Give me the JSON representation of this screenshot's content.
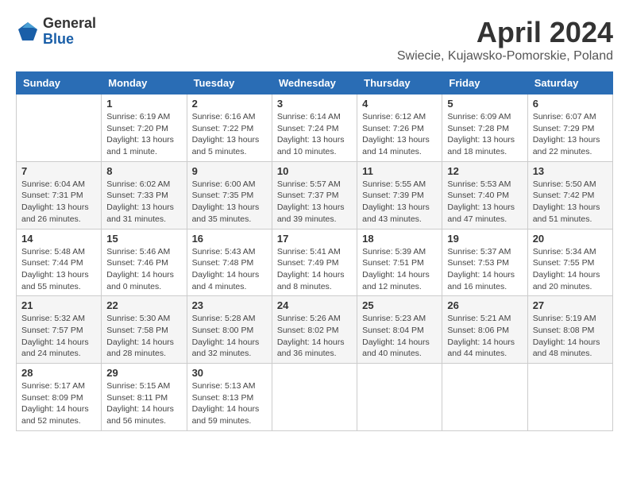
{
  "logo": {
    "general": "General",
    "blue": "Blue"
  },
  "header": {
    "month": "April 2024",
    "location": "Swiecie, Kujawsko-Pomorskie, Poland"
  },
  "weekdays": [
    "Sunday",
    "Monday",
    "Tuesday",
    "Wednesday",
    "Thursday",
    "Friday",
    "Saturday"
  ],
  "weeks": [
    [
      {
        "day": "",
        "info": ""
      },
      {
        "day": "1",
        "info": "Sunrise: 6:19 AM\nSunset: 7:20 PM\nDaylight: 13 hours\nand 1 minute."
      },
      {
        "day": "2",
        "info": "Sunrise: 6:16 AM\nSunset: 7:22 PM\nDaylight: 13 hours\nand 5 minutes."
      },
      {
        "day": "3",
        "info": "Sunrise: 6:14 AM\nSunset: 7:24 PM\nDaylight: 13 hours\nand 10 minutes."
      },
      {
        "day": "4",
        "info": "Sunrise: 6:12 AM\nSunset: 7:26 PM\nDaylight: 13 hours\nand 14 minutes."
      },
      {
        "day": "5",
        "info": "Sunrise: 6:09 AM\nSunset: 7:28 PM\nDaylight: 13 hours\nand 18 minutes."
      },
      {
        "day": "6",
        "info": "Sunrise: 6:07 AM\nSunset: 7:29 PM\nDaylight: 13 hours\nand 22 minutes."
      }
    ],
    [
      {
        "day": "7",
        "info": "Sunrise: 6:04 AM\nSunset: 7:31 PM\nDaylight: 13 hours\nand 26 minutes."
      },
      {
        "day": "8",
        "info": "Sunrise: 6:02 AM\nSunset: 7:33 PM\nDaylight: 13 hours\nand 31 minutes."
      },
      {
        "day": "9",
        "info": "Sunrise: 6:00 AM\nSunset: 7:35 PM\nDaylight: 13 hours\nand 35 minutes."
      },
      {
        "day": "10",
        "info": "Sunrise: 5:57 AM\nSunset: 7:37 PM\nDaylight: 13 hours\nand 39 minutes."
      },
      {
        "day": "11",
        "info": "Sunrise: 5:55 AM\nSunset: 7:39 PM\nDaylight: 13 hours\nand 43 minutes."
      },
      {
        "day": "12",
        "info": "Sunrise: 5:53 AM\nSunset: 7:40 PM\nDaylight: 13 hours\nand 47 minutes."
      },
      {
        "day": "13",
        "info": "Sunrise: 5:50 AM\nSunset: 7:42 PM\nDaylight: 13 hours\nand 51 minutes."
      }
    ],
    [
      {
        "day": "14",
        "info": "Sunrise: 5:48 AM\nSunset: 7:44 PM\nDaylight: 13 hours\nand 55 minutes."
      },
      {
        "day": "15",
        "info": "Sunrise: 5:46 AM\nSunset: 7:46 PM\nDaylight: 14 hours\nand 0 minutes."
      },
      {
        "day": "16",
        "info": "Sunrise: 5:43 AM\nSunset: 7:48 PM\nDaylight: 14 hours\nand 4 minutes."
      },
      {
        "day": "17",
        "info": "Sunrise: 5:41 AM\nSunset: 7:49 PM\nDaylight: 14 hours\nand 8 minutes."
      },
      {
        "day": "18",
        "info": "Sunrise: 5:39 AM\nSunset: 7:51 PM\nDaylight: 14 hours\nand 12 minutes."
      },
      {
        "day": "19",
        "info": "Sunrise: 5:37 AM\nSunset: 7:53 PM\nDaylight: 14 hours\nand 16 minutes."
      },
      {
        "day": "20",
        "info": "Sunrise: 5:34 AM\nSunset: 7:55 PM\nDaylight: 14 hours\nand 20 minutes."
      }
    ],
    [
      {
        "day": "21",
        "info": "Sunrise: 5:32 AM\nSunset: 7:57 PM\nDaylight: 14 hours\nand 24 minutes."
      },
      {
        "day": "22",
        "info": "Sunrise: 5:30 AM\nSunset: 7:58 PM\nDaylight: 14 hours\nand 28 minutes."
      },
      {
        "day": "23",
        "info": "Sunrise: 5:28 AM\nSunset: 8:00 PM\nDaylight: 14 hours\nand 32 minutes."
      },
      {
        "day": "24",
        "info": "Sunrise: 5:26 AM\nSunset: 8:02 PM\nDaylight: 14 hours\nand 36 minutes."
      },
      {
        "day": "25",
        "info": "Sunrise: 5:23 AM\nSunset: 8:04 PM\nDaylight: 14 hours\nand 40 minutes."
      },
      {
        "day": "26",
        "info": "Sunrise: 5:21 AM\nSunset: 8:06 PM\nDaylight: 14 hours\nand 44 minutes."
      },
      {
        "day": "27",
        "info": "Sunrise: 5:19 AM\nSunset: 8:08 PM\nDaylight: 14 hours\nand 48 minutes."
      }
    ],
    [
      {
        "day": "28",
        "info": "Sunrise: 5:17 AM\nSunset: 8:09 PM\nDaylight: 14 hours\nand 52 minutes."
      },
      {
        "day": "29",
        "info": "Sunrise: 5:15 AM\nSunset: 8:11 PM\nDaylight: 14 hours\nand 56 minutes."
      },
      {
        "day": "30",
        "info": "Sunrise: 5:13 AM\nSunset: 8:13 PM\nDaylight: 14 hours\nand 59 minutes."
      },
      {
        "day": "",
        "info": ""
      },
      {
        "day": "",
        "info": ""
      },
      {
        "day": "",
        "info": ""
      },
      {
        "day": "",
        "info": ""
      }
    ]
  ]
}
